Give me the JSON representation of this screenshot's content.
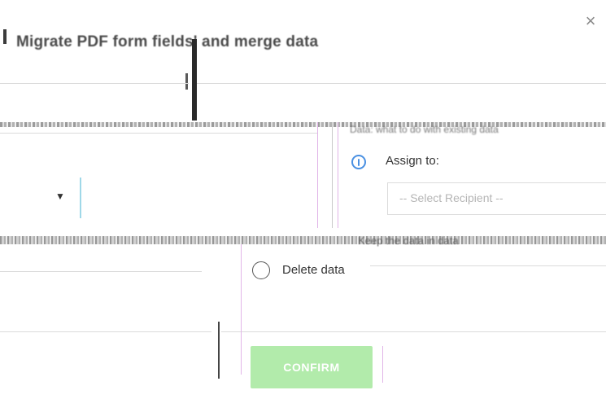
{
  "dialog": {
    "close_glyph": "×",
    "title": "Migrate PDF form fields' and merge data",
    "section_header": "Data: what to do with existing data",
    "keep_label": "Keep the data in data"
  },
  "left_form": {
    "dropdown_caret": "▼"
  },
  "options": {
    "assign_label": "Assign to:",
    "recipient_placeholder": "-- Select Recipient --",
    "delete_label": "Delete data"
  },
  "actions": {
    "confirm_label": "CONFIRM"
  },
  "colors": {
    "accent_blue": "#4a90e2",
    "confirm_bg": "#b2ebab",
    "guide_magenta": "#e1b5e8",
    "guide_cyan": "#9fd8e8"
  }
}
